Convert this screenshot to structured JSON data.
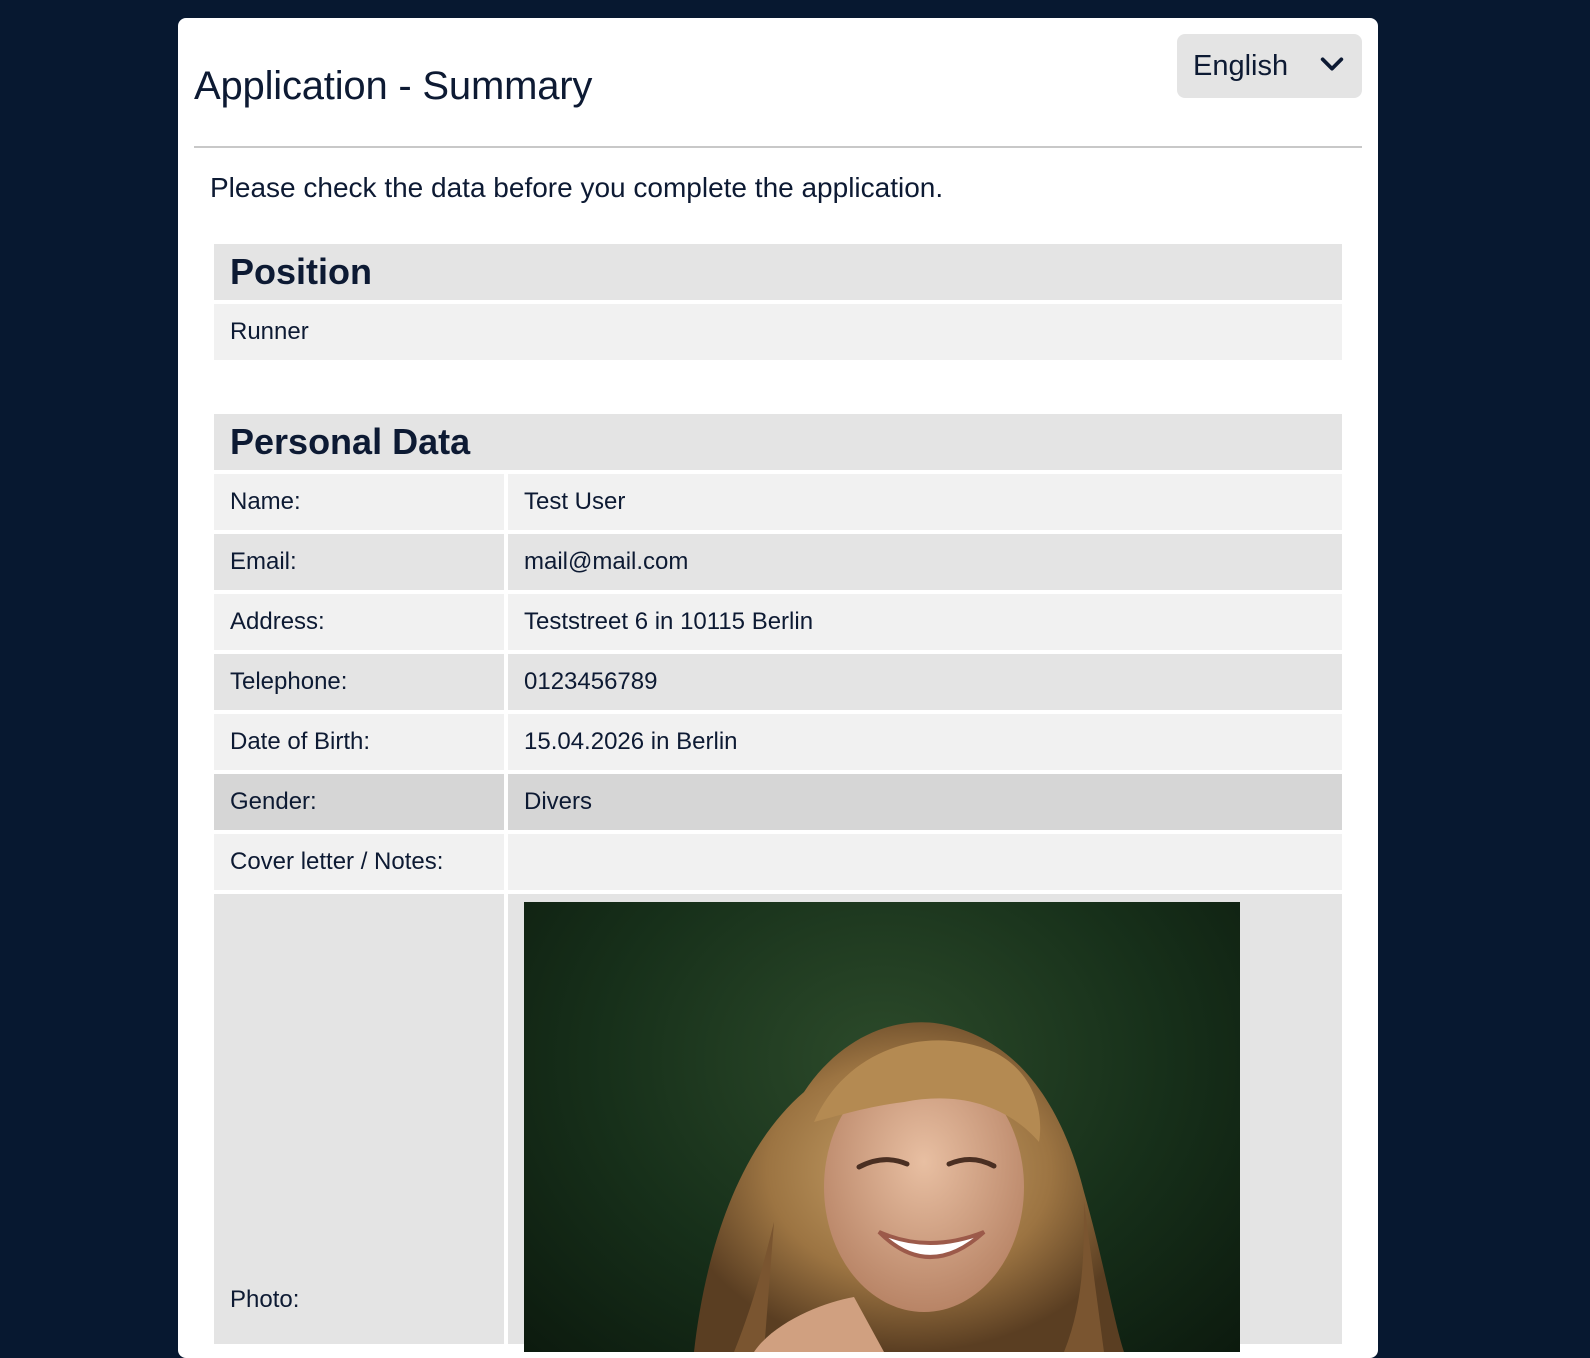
{
  "header": {
    "title": "Application - Summary",
    "language": {
      "selected": "English",
      "icon": "chevron-down-icon"
    }
  },
  "intro": "Please check the data before you complete the application.",
  "position": {
    "heading": "Position",
    "value": "Runner"
  },
  "personal": {
    "heading": "Personal Data",
    "rows": [
      {
        "label": "Name:",
        "value": "Test User"
      },
      {
        "label": "Email:",
        "value": "mail@mail.com"
      },
      {
        "label": "Address:",
        "value": "Teststreet 6 in 10115 Berlin"
      },
      {
        "label": "Telephone:",
        "value": "0123456789"
      },
      {
        "label": "Date of Birth:",
        "value": "15.04.2026 in Berlin"
      },
      {
        "label": "Gender:",
        "value": "Divers"
      },
      {
        "label": "Cover letter / Notes:",
        "value": ""
      },
      {
        "label": "Photo:",
        "value": ""
      }
    ]
  },
  "colors": {
    "page_bg": "#071830",
    "card_bg": "#ffffff",
    "row_light": "#f1f1f1",
    "row_dark": "#e4e4e4",
    "row_hover": "#d6d6d6",
    "text": "#0d1a33"
  }
}
